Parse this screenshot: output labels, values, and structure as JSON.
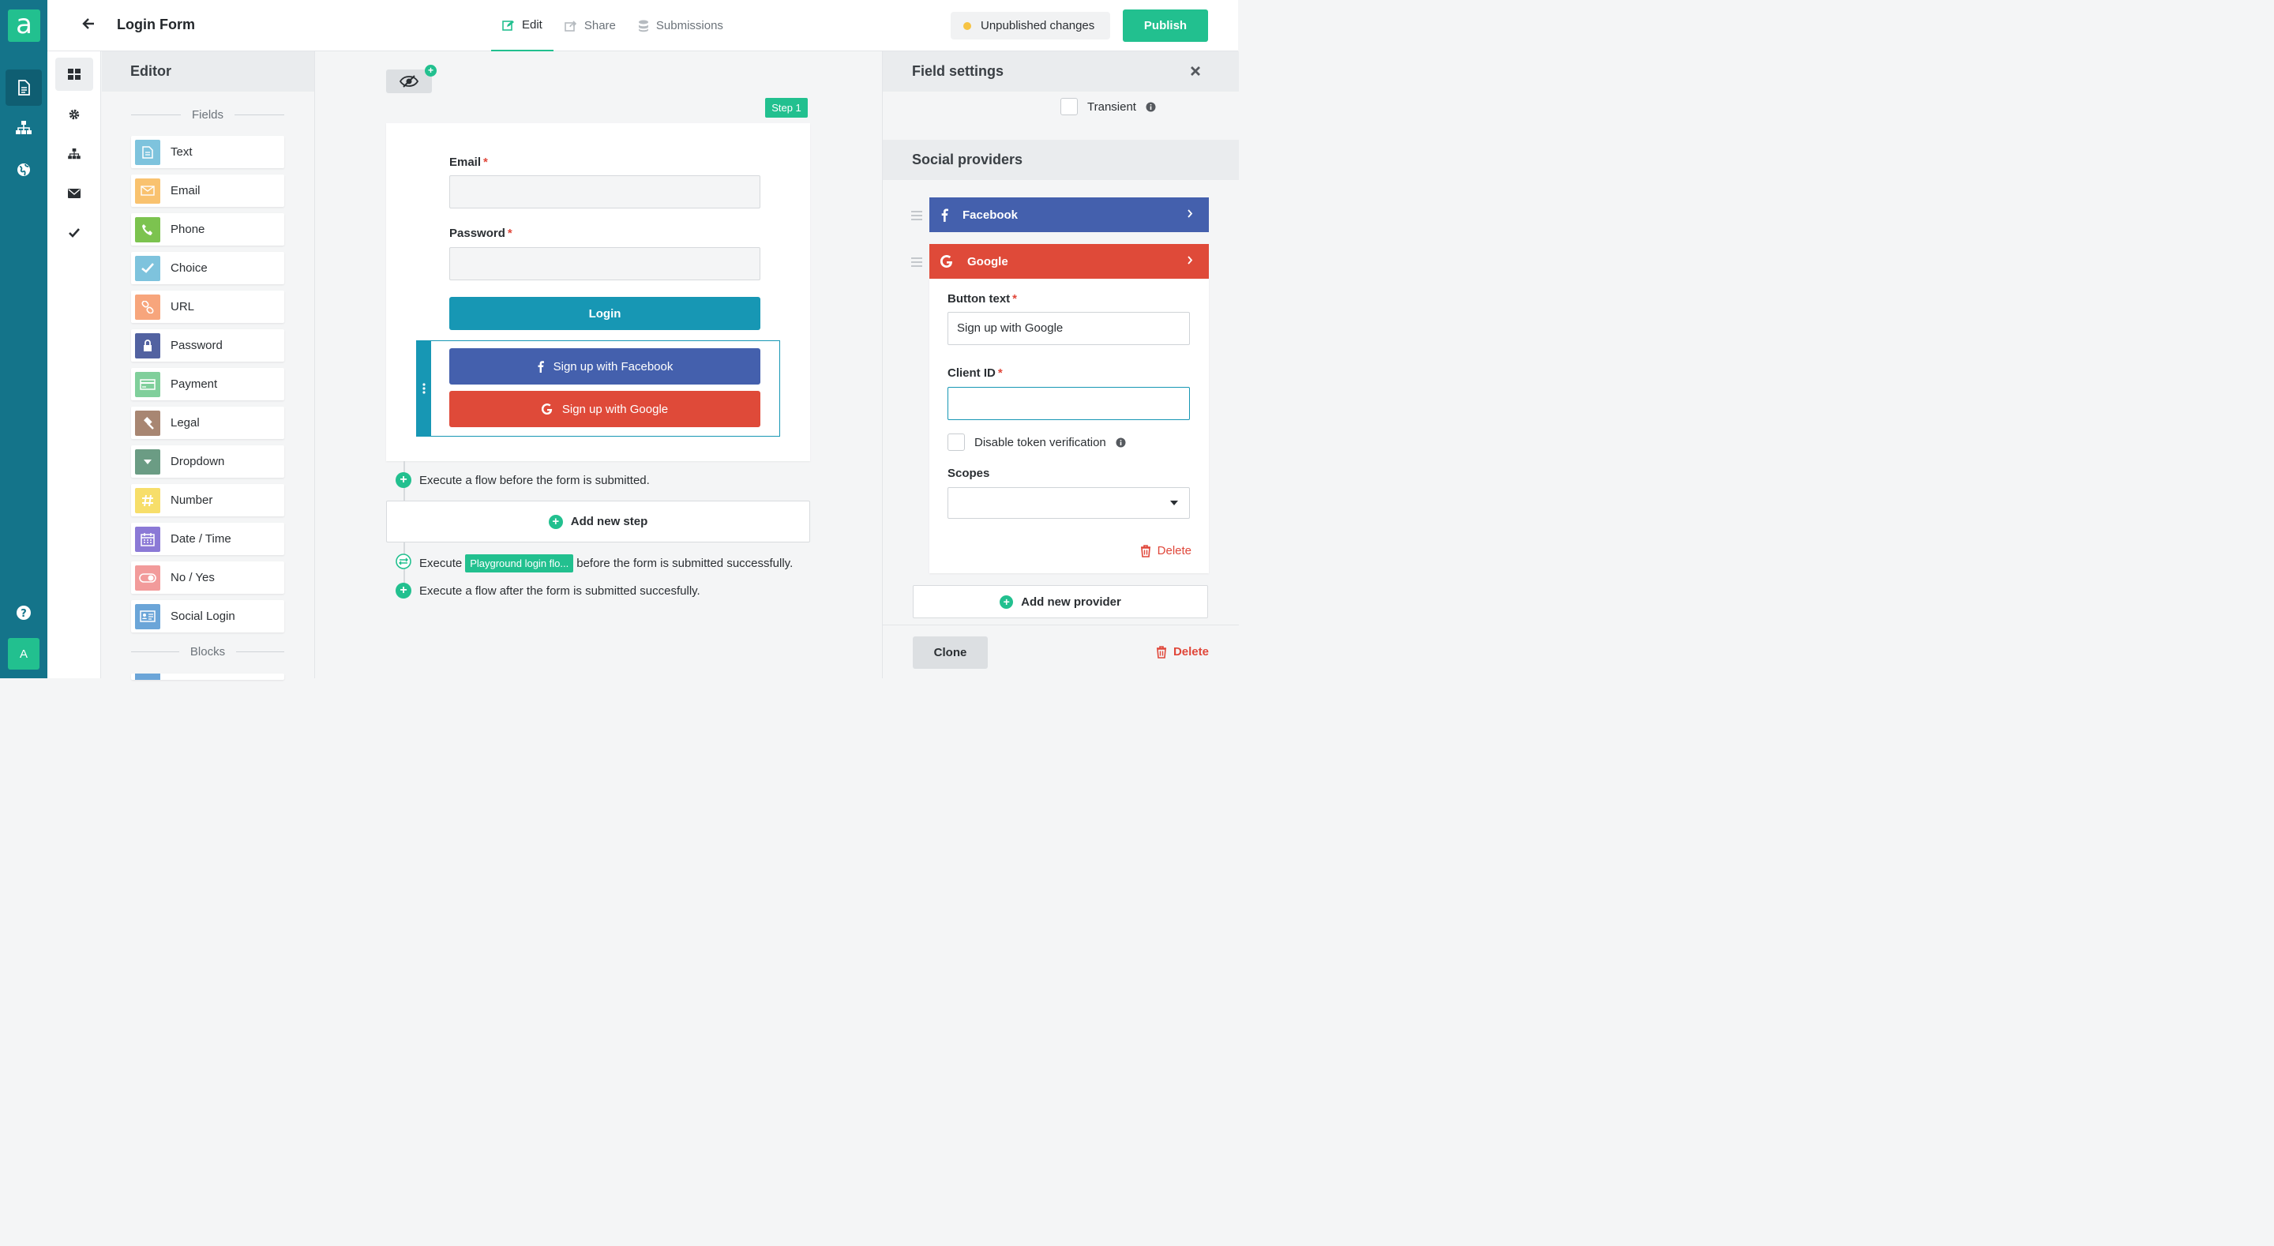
{
  "app": {
    "logo_letter": "a",
    "avatar_letter": "A",
    "title": "Login Form"
  },
  "tabs": [
    {
      "label": "Edit",
      "icon": "edit-icon"
    },
    {
      "label": "Share",
      "icon": "share-icon"
    },
    {
      "label": "Submissions",
      "icon": "database-icon"
    }
  ],
  "status": {
    "unpublished": "Unpublished changes",
    "publish": "Publish"
  },
  "editor": {
    "title": "Editor",
    "fields_header": "Fields",
    "blocks_header": "Blocks",
    "fields": [
      {
        "label": "Text",
        "icon": "text-doc-icon",
        "color": "#7ec3dd"
      },
      {
        "label": "Email",
        "icon": "envelope-icon",
        "color": "#f9c26f"
      },
      {
        "label": "Phone",
        "icon": "phone-icon",
        "color": "#7cc34f"
      },
      {
        "label": "Choice",
        "icon": "check-icon",
        "color": "#7ec3dd"
      },
      {
        "label": "URL",
        "icon": "link-icon",
        "color": "#f7a57c"
      },
      {
        "label": "Password",
        "icon": "lock-icon",
        "color": "#5262a1"
      },
      {
        "label": "Payment",
        "icon": "credit-card-icon",
        "color": "#80cf9b"
      },
      {
        "label": "Legal",
        "icon": "gavel-icon",
        "color": "#a88672"
      },
      {
        "label": "Dropdown",
        "icon": "caret-down-icon",
        "color": "#6b9c84"
      },
      {
        "label": "Number",
        "icon": "hash-icon",
        "color": "#f7de6a"
      },
      {
        "label": "Date / Time",
        "icon": "calendar-icon",
        "color": "#8b79d6"
      },
      {
        "label": "No / Yes",
        "icon": "toggle-icon",
        "color": "#f29b9b"
      },
      {
        "label": "Social Login",
        "icon": "id-card-icon",
        "color": "#6ba5d8"
      }
    ]
  },
  "canvas": {
    "step_badge": "Step 1",
    "email_label": "Email",
    "password_label": "Password",
    "required_mark": "*",
    "login_button": "Login",
    "facebook_button": "Sign up with Facebook",
    "google_button": "Sign up with Google",
    "flow_before": "Execute a flow before the form is submitted.",
    "add_step": "Add new step",
    "execute_word": "Execute",
    "flow_chip": "Playground login flo...",
    "flow_after_success": "before the form is submitted successfully.",
    "flow_after": "Execute a flow after the form is submitted succesfully."
  },
  "settings": {
    "title": "Field settings",
    "transient": "Transient",
    "social_title": "Social providers",
    "providers": [
      {
        "name": "Facebook",
        "color": "#4460ad"
      },
      {
        "name": "Google",
        "color": "#df4a39"
      }
    ],
    "button_text_label": "Button text",
    "button_text_value": "Sign up with Google",
    "client_id_label": "Client ID",
    "client_id_value": "",
    "disable_token": "Disable token verification",
    "scopes_label": "Scopes",
    "delete_provider": "Delete",
    "add_provider": "Add new provider",
    "clone": "Clone",
    "delete": "Delete"
  }
}
